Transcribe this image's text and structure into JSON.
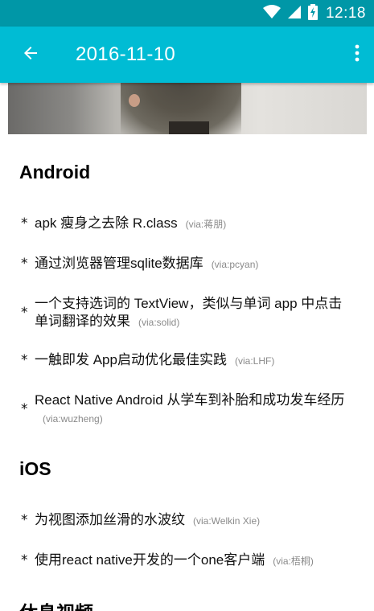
{
  "status_bar": {
    "time": "12:18",
    "icons": [
      "wifi-icon",
      "cell-signal-icon",
      "battery-charging-icon"
    ]
  },
  "app_bar": {
    "title": "2016-11-10",
    "back_icon": "arrow-left-icon",
    "menu_icon": "more-vert-icon"
  },
  "sections": [
    {
      "title": "Android",
      "items": [
        {
          "text": "apk 瘦身之去除 R.class",
          "via": "(via:蒋朋)"
        },
        {
          "text": "通过浏览器管理sqlite数据库",
          "via": "(via:pcyan)"
        },
        {
          "text": "一个支持选词的 TextView，类似与单词 app 中点击单词翻译的效果",
          "via": "(via:solid)"
        },
        {
          "text": "一触即发 App启动优化最佳实践",
          "via": "(via:LHF)"
        },
        {
          "text": " React Native Android 从学车到补胎和成功发车经历",
          "via": "(via:wuzheng)"
        }
      ]
    },
    {
      "title": "iOS",
      "items": [
        {
          "text": "为视图添加丝滑的水波纹",
          "via": "(via:Welkin Xie)"
        },
        {
          "text": "使用react native开发的一个one客户端",
          "via": "(via:梧桐)"
        }
      ]
    },
    {
      "title": "休息视频",
      "items": []
    }
  ],
  "bullet_char": "*",
  "colors": {
    "status_bar": "#0097a7",
    "app_bar": "#00bcd4",
    "via_text": "#8a8a8a"
  }
}
